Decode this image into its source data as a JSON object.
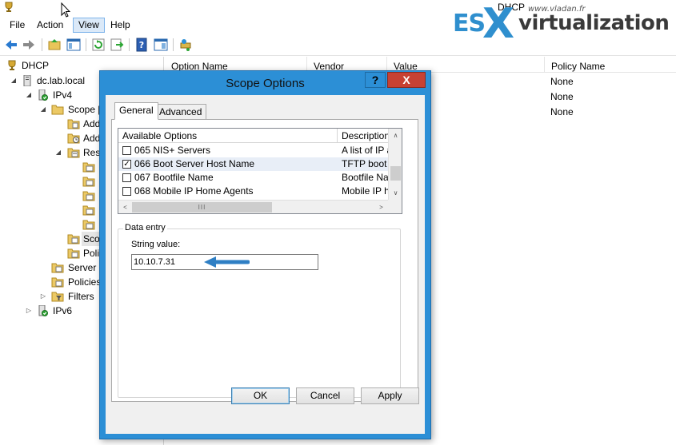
{
  "window": {
    "title": "DHCP"
  },
  "menu": [
    "File",
    "Action",
    "View",
    "Help"
  ],
  "toolbar": [
    "back-arrow-icon",
    "forward-arrow-icon",
    "up-folder-icon",
    "show-hide-tree-icon",
    "refresh-icon",
    "export-list-icon",
    "help-icon",
    "properties-icon",
    "connect-icon"
  ],
  "tree": {
    "root": "DHCP",
    "server": "dc.lab.local",
    "ipv4": "IPv4",
    "scope": "Scope [",
    "scope_children": [
      "Add",
      "Add",
      "Rese"
    ],
    "scope_options": "Scop",
    "policies_child": "Poli",
    "server_options": "Server O",
    "policies": "Policies",
    "filters": "Filters",
    "ipv6": "IPv6"
  },
  "list": {
    "columns": [
      "Option Name",
      "Vendor",
      "Value",
      "Policy Name"
    ],
    "rows": [
      {
        "policy": "None"
      },
      {
        "policy": "None"
      },
      {
        "policy": "None"
      }
    ]
  },
  "logo": {
    "site": "www.vladan.fr",
    "text_esx": "ES",
    "text_x": "X",
    "text_virt": "virtualization"
  },
  "dialog": {
    "title": "Scope Options",
    "help_glyph": "?",
    "close_glyph": "X",
    "tabs": [
      "General",
      "Advanced"
    ],
    "options_columns": [
      "Available Options",
      "Description"
    ],
    "options": [
      {
        "name": "065 NIS+ Servers",
        "desc": "A list of IP a",
        "checked": false
      },
      {
        "name": "066 Boot Server Host Name",
        "desc": "TFTP boot s",
        "checked": true
      },
      {
        "name": "067 Bootfile Name",
        "desc": "Bootfile Nam",
        "checked": false
      },
      {
        "name": "068 Mobile IP Home Agents",
        "desc": "Mobile IP ho",
        "checked": false
      }
    ],
    "hscroll_grip": "III",
    "data_entry_label": "Data entry",
    "string_value_label": "String value:",
    "string_value": "10.10.7.31",
    "buttons": {
      "ok": "OK",
      "cancel": "Cancel",
      "apply": "Apply"
    }
  },
  "colors": {
    "dialog_frame": "#2c8fd6",
    "close_button": "#c74133",
    "arrow": "#2f7fc4"
  }
}
